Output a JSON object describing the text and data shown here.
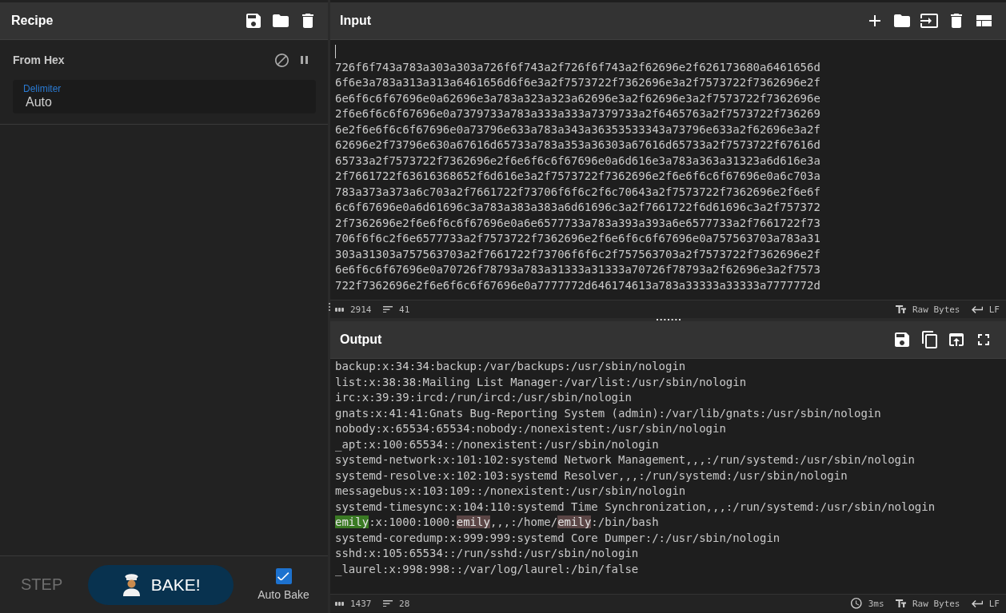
{
  "recipe": {
    "title": "Recipe",
    "operations": [
      {
        "name": "From Hex",
        "disabled": false,
        "paused": false,
        "args": [
          {
            "kind": "text",
            "label": "Delimiter",
            "value": "Auto"
          }
        ]
      }
    ]
  },
  "controls": {
    "step_label": "STEP",
    "bake_label": "BAKE!",
    "auto_bake": {
      "label": "Auto Bake",
      "checked": true
    }
  },
  "input": {
    "title": "Input",
    "value_lines": [
      "726f6f743a783a303a303a726f6f743a2f726f6f743a2f62696e2f626173680a6461656d",
      "6f6e3a783a313a313a6461656d6f6e3a2f7573722f7362696e3a2f7573722f7362696e2f",
      "6e6f6c6f67696e0a62696e3a783a323a323a62696e3a2f62696e3a2f7573722f7362696e",
      "2f6e6f6c6f67696e0a7379733a783a333a333a7379733a2f6465763a2f7573722f736269",
      "6e2f6e6f6c6f67696e0a73796e633a783a343a36353533343a73796e633a2f62696e3a2f",
      "62696e2f73796e630a67616d65733a783a353a36303a67616d65733a2f7573722f67616d",
      "65733a2f7573722f7362696e2f6e6f6c6f67696e0a6d616e3a783a363a31323a6d616e3a",
      "2f7661722f63616368652f6d616e3a2f7573722f7362696e2f6e6f6c6f67696e0a6c703a",
      "783a373a373a6c703a2f7661722f73706f6f6c2f6c70643a2f7573722f7362696e2f6e6f",
      "6c6f67696e0a6d61696c3a783a383a383a6d61696c3a2f7661722f6d61696c3a2f757372",
      "2f7362696e2f6e6f6c6f67696e0a6e6577733a783a393a393a6e6577733a2f7661722f73",
      "706f6f6c2f6e6577733a2f7573722f7362696e2f6e6f6c6f67696e0a757563703a783a31",
      "303a31303a757563703a2f7661722f73706f6f6c2f757563703a2f7573722f7362696e2f",
      "6e6f6c6f67696e0a70726f78793a783a31333a31333a70726f78793a2f62696e3a2f7573",
      "722f7362696e2f6e6f6c6f67696e0a7777772d646174613a783a33333a33333a7777772d"
    ],
    "status": {
      "length": "2914",
      "lines": "41",
      "encoding": "Raw Bytes",
      "eol": "LF"
    }
  },
  "output": {
    "title": "Output",
    "lines": [
      {
        "text": "backup:x:34:34:backup:/var/backups:/usr/sbin/nologin"
      },
      {
        "text": "list:x:38:38:Mailing List Manager:/var/list:/usr/sbin/nologin"
      },
      {
        "text": "irc:x:39:39:ircd:/run/ircd:/usr/sbin/nologin"
      },
      {
        "text": "gnats:x:41:41:Gnats Bug-Reporting System (admin):/var/lib/gnats:/usr/sbin/nologin"
      },
      {
        "text": "nobody:x:65534:65534:nobody:/nonexistent:/usr/sbin/nologin"
      },
      {
        "text": "_apt:x:100:65534::/nonexistent:/usr/sbin/nologin"
      },
      {
        "text": "systemd-network:x:101:102:systemd Network Management,,,:/run/systemd:/usr/sbin/nologin"
      },
      {
        "text": "systemd-resolve:x:102:103:systemd Resolver,,,:/run/systemd:/usr/sbin/nologin"
      },
      {
        "text": "messagebus:x:103:109::/nonexistent:/usr/sbin/nologin"
      },
      {
        "text": "systemd-timesync:x:104:110:systemd Time Synchronization,,,:/run/systemd:/usr/sbin/nologin"
      },
      {
        "segments": [
          {
            "text": "emily",
            "highlighted": true,
            "selected": true
          },
          {
            "text": ":x:1000:1000:",
            "highlighted": false,
            "selected": false
          },
          {
            "text": "emily",
            "highlighted": true,
            "selected": false
          },
          {
            "text": ",,,:/home/",
            "highlighted": false,
            "selected": false
          },
          {
            "text": "emily",
            "highlighted": true,
            "selected": false
          },
          {
            "text": ":/bin/bash",
            "highlighted": false,
            "selected": false
          }
        ]
      },
      {
        "text": "systemd-coredump:x:999:999:systemd Core Dumper:/:/usr/sbin/nologin"
      },
      {
        "text": "sshd:x:105:65534::/run/sshd:/usr/sbin/nologin"
      },
      {
        "text": "_laurel:x:998:998::/var/log/laurel:/bin/false"
      }
    ],
    "status": {
      "length": "1437",
      "lines": "28",
      "time": "3ms",
      "encoding": "Raw Bytes",
      "eol": "LF"
    }
  }
}
